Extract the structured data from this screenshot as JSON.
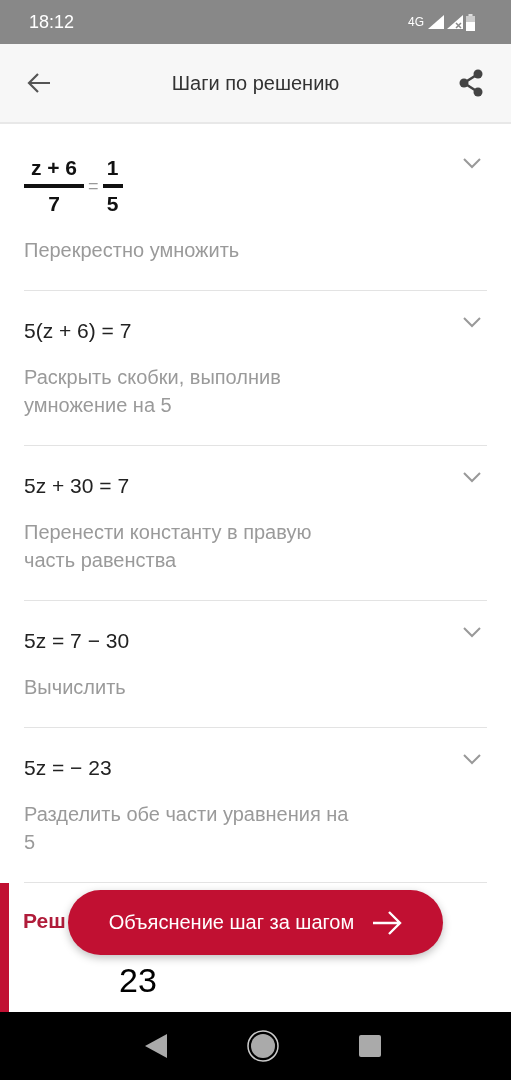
{
  "status_bar": {
    "time": "18:12",
    "network": "4G"
  },
  "app_bar": {
    "title": "Шаги по решению"
  },
  "steps": [
    {
      "kind": "fraction",
      "left": {
        "numerator": "z + 6",
        "denominator": "7"
      },
      "sign": "=",
      "right": {
        "numerator": "1",
        "denominator": "5"
      },
      "description": "Перекрестно умножить",
      "expanded": false
    },
    {
      "kind": "plain",
      "expression": "5(z + 6) = 7",
      "description": "Раскрыть скобки, выполнив умножение на 5",
      "expanded": false
    },
    {
      "kind": "plain",
      "expression": "5z + 30 = 7",
      "description": "Перенести константу в правую часть равенства",
      "expanded": false
    },
    {
      "kind": "plain",
      "expression": "5z = 7 − 30",
      "description": "Вычислить",
      "expanded": false
    },
    {
      "kind": "plain",
      "expression": "5z = − 23",
      "description": "Разделить обе части уравнения на 5",
      "expanded": false
    }
  ],
  "solution": {
    "heading": "Реш",
    "value": "23"
  },
  "fab": {
    "label": "Объяснение шаг за шагом"
  }
}
